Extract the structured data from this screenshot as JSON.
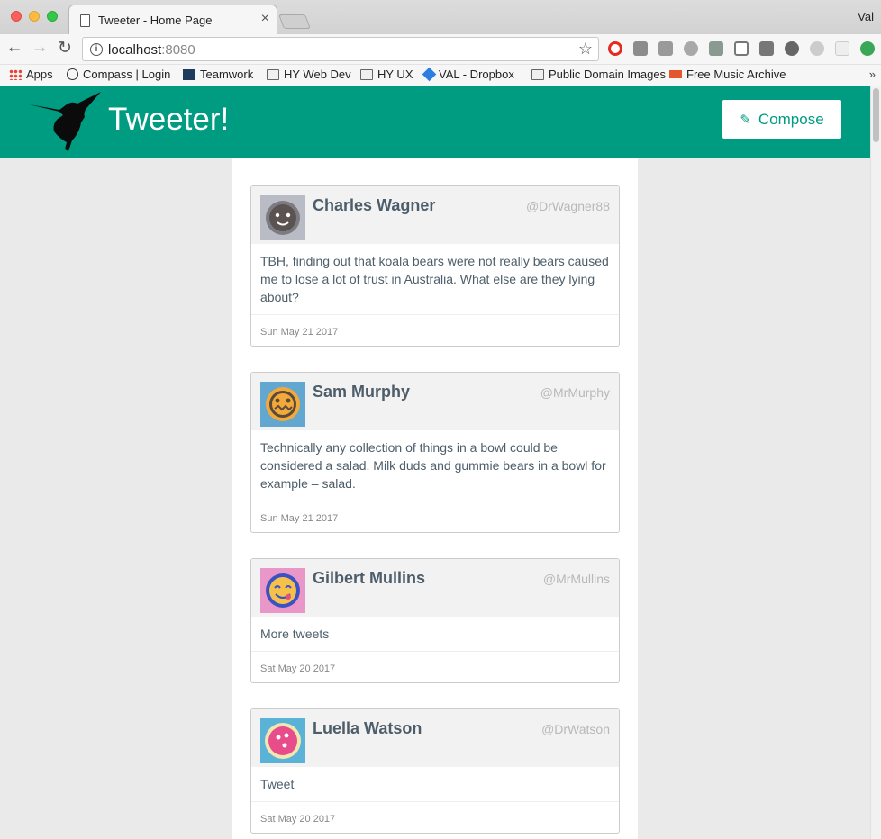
{
  "browser": {
    "tab_title": "Tweeter - Home Page",
    "profile": "Val",
    "url_host": "localhost",
    "url_port": ":8080",
    "bookmarks": [
      "Apps",
      "Compass | Login",
      "Teamwork",
      "HY Web Dev",
      "HY UX",
      "VAL - Dropbox",
      "Public Domain Images",
      "Free Music Archive"
    ],
    "more_label": "»"
  },
  "app": {
    "title": "Tweeter!",
    "compose_label": "Compose",
    "accent_color": "#009c82"
  },
  "tweets": [
    {
      "name": "Charles Wagner",
      "handle": "@DrWagner88",
      "text": "TBH, finding out that koala bears were not really bears caused me to lose a lot of trust in Australia. What else are they lying about?",
      "date": "Sun May 21 2017",
      "avatar_bg": "#b9bcc4",
      "avatar_fg": "#5a5350"
    },
    {
      "name": "Sam Murphy",
      "handle": "@MrMurphy",
      "text": "Technically any collection of things in a bowl could be considered a salad. Milk duds and gummie bears in a bowl for example – salad.",
      "date": "Sun May 21 2017",
      "avatar_bg": "#62a7cf",
      "avatar_fg": "#f3a83a"
    },
    {
      "name": "Gilbert Mullins",
      "handle": "@MrMullins",
      "text": "More tweets",
      "date": "Sat May 20 2017",
      "avatar_bg": "#e897c8",
      "avatar_fg": "#3a52c4"
    },
    {
      "name": "Luella Watson",
      "handle": "@DrWatson",
      "text": "Tweet",
      "date": "Sat May 20 2017",
      "avatar_bg": "#5ab2d6",
      "avatar_fg": "#e84c8a"
    }
  ]
}
